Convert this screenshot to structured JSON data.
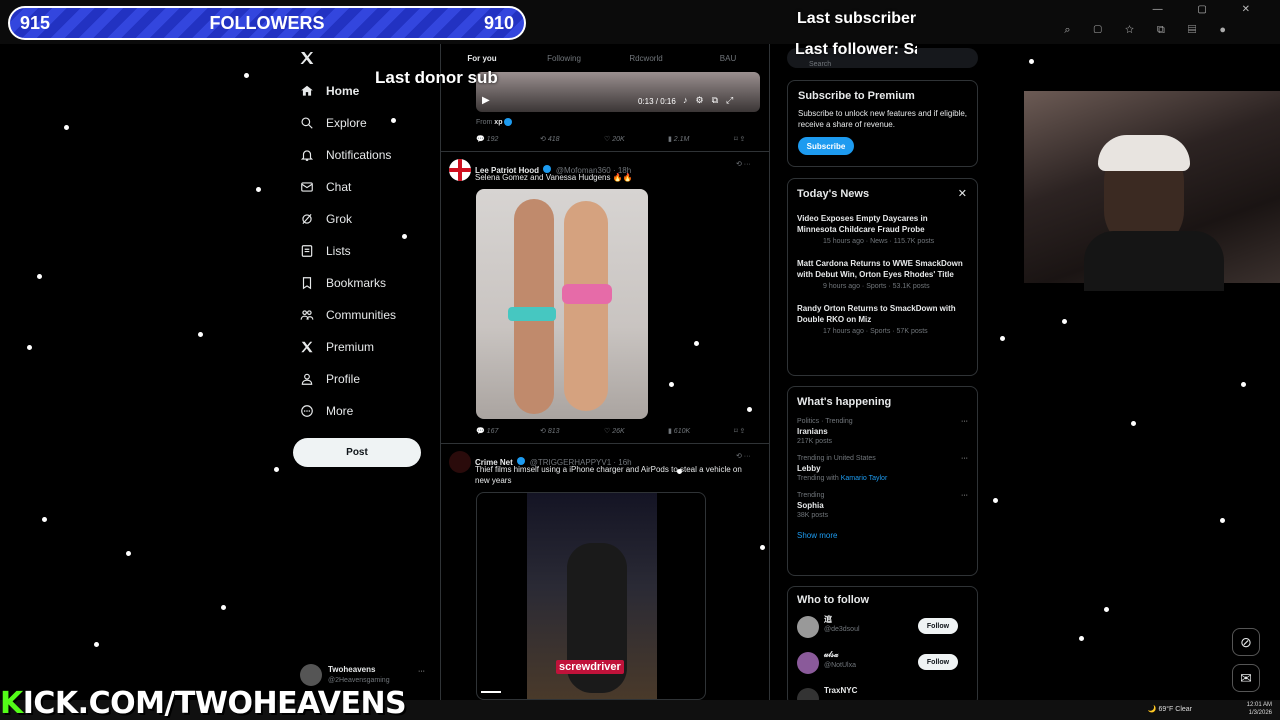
{
  "overlay": {
    "followers_left": "915",
    "followers_label": "FOLLOWERS",
    "followers_right": "910",
    "last_subscriber": "Last subscriber",
    "last_follower": "Last follower: Sa",
    "last_donor_sub": "Last donor sub",
    "kick_prefix": "K",
    "kick_url": "ICK.COM/TWOHEAVENS"
  },
  "nav": {
    "items": [
      {
        "label": "Home",
        "icon": "home-icon"
      },
      {
        "label": "Explore",
        "icon": "search-icon"
      },
      {
        "label": "Notifications",
        "icon": "bell-icon"
      },
      {
        "label": "Chat",
        "icon": "mail-icon"
      },
      {
        "label": "Grok",
        "icon": "grok-icon"
      },
      {
        "label": "Lists",
        "icon": "list-icon"
      },
      {
        "label": "Bookmarks",
        "icon": "bookmark-icon"
      },
      {
        "label": "Communities",
        "icon": "people-icon"
      },
      {
        "label": "Premium",
        "icon": "x-icon"
      },
      {
        "label": "Profile",
        "icon": "person-icon"
      },
      {
        "label": "More",
        "icon": "more-icon"
      }
    ],
    "post_label": "Post",
    "account_name": "Twoheavens",
    "account_handle": "@2Heavensgaming"
  },
  "tabs": [
    "For you",
    "Following",
    "Rdcworld",
    "BAU"
  ],
  "video_player": {
    "time": "0:13 / 0:16"
  },
  "tweet0": {
    "from_label": "From",
    "from_name": "xp",
    "stats": {
      "replies": "192",
      "reposts": "418",
      "likes": "20K",
      "views": "2.1M"
    }
  },
  "tweet1": {
    "name": "Lee Patriot Hood",
    "handle": "@Mofoman360 · 18h",
    "text": "Selena Gomez and Vanessa Hudgens 🔥🔥",
    "stats": {
      "replies": "167",
      "reposts": "813",
      "likes": "26K",
      "views": "610K"
    }
  },
  "tweet2": {
    "name": "Crime Net",
    "handle": "@TRIGGERHAPPYV1 · 16h",
    "text": "Thief films himself using a iPhone charger and AirPods to steal a vehicle on new years",
    "caption": "screwdriver"
  },
  "sidebar": {
    "search_placeholder": "Search",
    "premium": {
      "title": "Subscribe to Premium",
      "body": "Subscribe to unlock new features and if eligible, receive a share of revenue.",
      "button": "Subscribe"
    },
    "news": {
      "title": "Today's News",
      "items": [
        {
          "headline": "Video Exposes Empty Daycares in Minnesota Childcare Fraud Probe",
          "meta": "15 hours ago · News · 115.7K posts"
        },
        {
          "headline": "Matt Cardona Returns to WWE SmackDown with Debut Win, Orton Eyes Rhodes' Title",
          "meta": "9 hours ago · Sports · 53.1K posts"
        },
        {
          "headline": "Randy Orton Returns to SmackDown with Double RKO on Miz",
          "meta": "17 hours ago · Sports · 57K posts"
        }
      ]
    },
    "happening": {
      "title": "What's happening",
      "items": [
        {
          "context": "Politics · Trending",
          "name": "Iranians",
          "meta": "217K posts"
        },
        {
          "context": "Trending in United States",
          "name": "Lebby",
          "meta": "Trending with",
          "link": "Kamario Taylor"
        },
        {
          "context": "Trending",
          "name": "Sophia",
          "meta": "38K posts"
        }
      ],
      "show_more": "Show more"
    },
    "who_to_follow": {
      "title": "Who to follow",
      "follow_label": "Follow",
      "accounts": [
        {
          "name": "逭",
          "handle": "@de3dsoul"
        },
        {
          "name": "𝓊𝓁𝓈𝒶",
          "handle": "@NotUlxa"
        },
        {
          "name": "TraxNYC",
          "handle": ""
        }
      ]
    }
  },
  "taskbar": {
    "weather": "69°F",
    "condition": "Clear",
    "time": "12:01 AM",
    "date": "1/3/2026"
  },
  "colors": {
    "accent": "#1d9bf0",
    "kick_green": "#53fc18",
    "overlay_blue": "#2a3bd0"
  }
}
